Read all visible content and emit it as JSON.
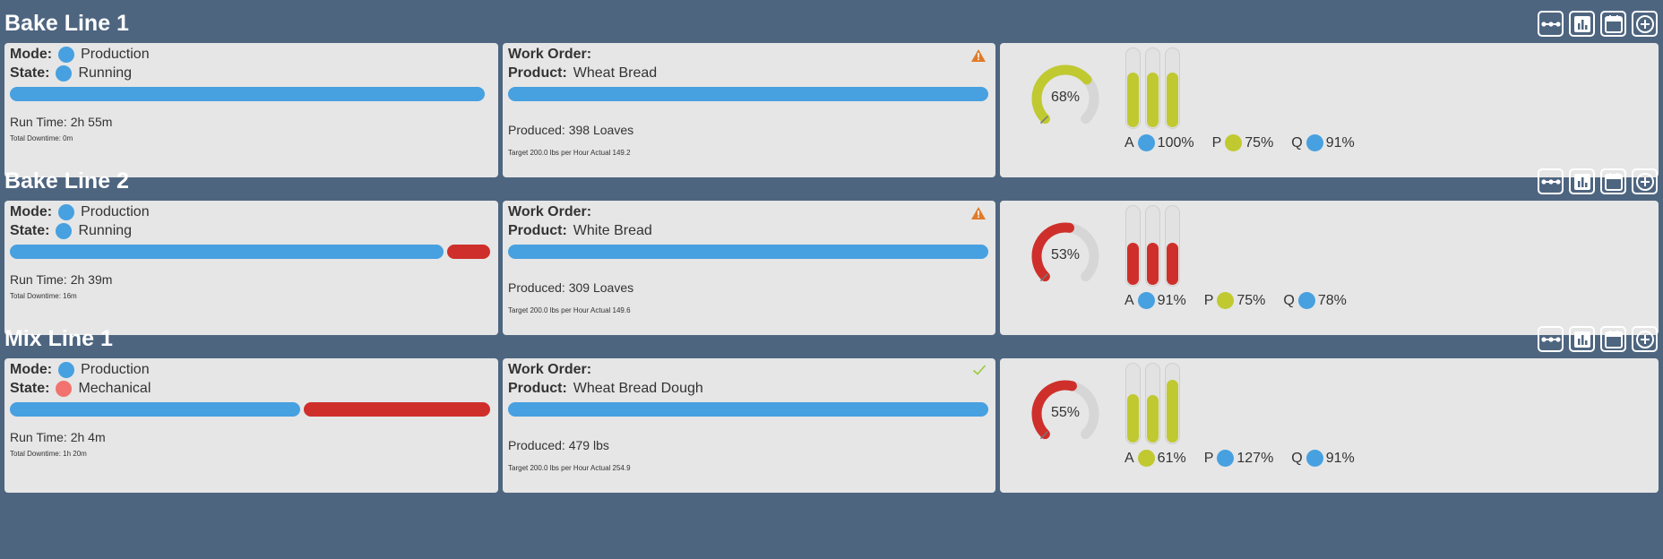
{
  "colors": {
    "background": "#4e6580",
    "panel": "#e6e6e6",
    "blue": "#47a0e0",
    "red": "#cf2f2b",
    "lime": "#c0c930",
    "salmon": "#f2726f",
    "warning": "#e07b2a",
    "ok": "#9cc93a"
  },
  "toolbar_icons": [
    "timeline-icon",
    "bar-chart-icon",
    "calendar-icon",
    "add-circle-icon"
  ],
  "lines": [
    {
      "title": "Bake Line 1",
      "mode_label": "Mode:",
      "mode_value": "Production",
      "mode_color": "#47a0e0",
      "state_label": "State:",
      "state_value": "Running",
      "state_color": "#47a0e0",
      "runtime_fraction": 1.0,
      "runtime_text": "Run Time: 2h 55m",
      "downtime_text": "Total Downtime: 0m",
      "work_order_label": "Work Order:",
      "product_label": "Product:",
      "product_value": "Wheat Bread",
      "status_icon": "warning-icon",
      "produced_text": "Produced: 398 Loaves",
      "target_text": "Target 200.0 lbs per Hour Actual 149.2",
      "oee_percent": 68,
      "oee_text": "68%",
      "oee_color": "#c0c930",
      "metrics": [
        {
          "key": "A",
          "value": 100,
          "text": "100%",
          "color": "#47a0e0",
          "bar_color": "#c0c930"
        },
        {
          "key": "P",
          "value": 75,
          "text": "75%",
          "color": "#c0c930",
          "bar_color": "#c0c930"
        },
        {
          "key": "Q",
          "value": 91,
          "text": "91%",
          "color": "#47a0e0",
          "bar_color": "#c0c930"
        }
      ],
      "bar_levels": [
        0.68,
        0.68,
        0.68
      ]
    },
    {
      "title": "Bake Line 2",
      "mode_label": "Mode:",
      "mode_value": "Production",
      "mode_color": "#47a0e0",
      "state_label": "State:",
      "state_value": "Running",
      "state_color": "#47a0e0",
      "runtime_fraction": 0.907,
      "runtime_text": "Run Time: 2h 39m",
      "downtime_text": "Total Downtime: 16m",
      "work_order_label": "Work Order:",
      "product_label": "Product:",
      "product_value": "White Bread",
      "status_icon": "warning-icon",
      "produced_text": "Produced: 309 Loaves",
      "target_text": "Target 200.0 lbs per Hour Actual 149.6",
      "oee_percent": 53,
      "oee_text": "53%",
      "oee_color": "#cf2f2b",
      "metrics": [
        {
          "key": "A",
          "value": 91,
          "text": "91%",
          "color": "#47a0e0",
          "bar_color": "#cf2f2b"
        },
        {
          "key": "P",
          "value": 75,
          "text": "75%",
          "color": "#c0c930",
          "bar_color": "#cf2f2b"
        },
        {
          "key": "Q",
          "value": 78,
          "text": "78%",
          "color": "#47a0e0",
          "bar_color": "#cf2f2b"
        }
      ],
      "bar_levels": [
        0.53,
        0.53,
        0.53
      ]
    },
    {
      "title": "Mix Line 1",
      "mode_label": "Mode:",
      "mode_value": "Production",
      "mode_color": "#47a0e0",
      "state_label": "State:",
      "state_value": "Mechanical",
      "state_color": "#f2726f",
      "runtime_fraction": 0.608,
      "runtime_text": "Run Time: 2h 4m",
      "downtime_text": "Total Downtime: 1h 20m",
      "work_order_label": "Work Order:",
      "product_label": "Product:",
      "product_value": "Wheat Bread Dough",
      "status_icon": "check-icon",
      "produced_text": "Produced: 479 lbs",
      "target_text": "Target 200.0 lbs per Hour Actual 254.9",
      "oee_percent": 55,
      "oee_text": "55%",
      "oee_color": "#cf2f2b",
      "metrics": [
        {
          "key": "A",
          "value": 61,
          "text": "61%",
          "color": "#c0c930",
          "bar_color": "#c0c930"
        },
        {
          "key": "P",
          "value": 127,
          "text": "127%",
          "color": "#47a0e0",
          "bar_color": "#c0c930"
        },
        {
          "key": "Q",
          "value": 91,
          "text": "91%",
          "color": "#47a0e0",
          "bar_color": "#c0c930"
        }
      ],
      "bar_levels": [
        0.61,
        0.59,
        0.79
      ]
    }
  ]
}
